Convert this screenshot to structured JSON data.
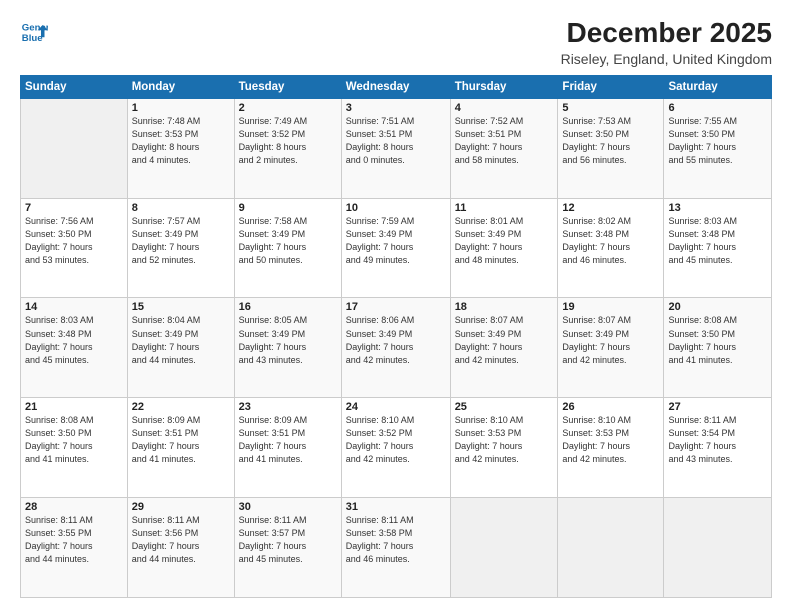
{
  "header": {
    "logo_line1": "General",
    "logo_line2": "Blue",
    "title": "December 2025",
    "subtitle": "Riseley, England, United Kingdom"
  },
  "calendar": {
    "days_of_week": [
      "Sunday",
      "Monday",
      "Tuesday",
      "Wednesday",
      "Thursday",
      "Friday",
      "Saturday"
    ],
    "weeks": [
      [
        {
          "day": "",
          "info": ""
        },
        {
          "day": "1",
          "info": "Sunrise: 7:48 AM\nSunset: 3:53 PM\nDaylight: 8 hours\nand 4 minutes."
        },
        {
          "day": "2",
          "info": "Sunrise: 7:49 AM\nSunset: 3:52 PM\nDaylight: 8 hours\nand 2 minutes."
        },
        {
          "day": "3",
          "info": "Sunrise: 7:51 AM\nSunset: 3:51 PM\nDaylight: 8 hours\nand 0 minutes."
        },
        {
          "day": "4",
          "info": "Sunrise: 7:52 AM\nSunset: 3:51 PM\nDaylight: 7 hours\nand 58 minutes."
        },
        {
          "day": "5",
          "info": "Sunrise: 7:53 AM\nSunset: 3:50 PM\nDaylight: 7 hours\nand 56 minutes."
        },
        {
          "day": "6",
          "info": "Sunrise: 7:55 AM\nSunset: 3:50 PM\nDaylight: 7 hours\nand 55 minutes."
        }
      ],
      [
        {
          "day": "7",
          "info": "Sunrise: 7:56 AM\nSunset: 3:50 PM\nDaylight: 7 hours\nand 53 minutes."
        },
        {
          "day": "8",
          "info": "Sunrise: 7:57 AM\nSunset: 3:49 PM\nDaylight: 7 hours\nand 52 minutes."
        },
        {
          "day": "9",
          "info": "Sunrise: 7:58 AM\nSunset: 3:49 PM\nDaylight: 7 hours\nand 50 minutes."
        },
        {
          "day": "10",
          "info": "Sunrise: 7:59 AM\nSunset: 3:49 PM\nDaylight: 7 hours\nand 49 minutes."
        },
        {
          "day": "11",
          "info": "Sunrise: 8:01 AM\nSunset: 3:49 PM\nDaylight: 7 hours\nand 48 minutes."
        },
        {
          "day": "12",
          "info": "Sunrise: 8:02 AM\nSunset: 3:48 PM\nDaylight: 7 hours\nand 46 minutes."
        },
        {
          "day": "13",
          "info": "Sunrise: 8:03 AM\nSunset: 3:48 PM\nDaylight: 7 hours\nand 45 minutes."
        }
      ],
      [
        {
          "day": "14",
          "info": "Sunrise: 8:03 AM\nSunset: 3:48 PM\nDaylight: 7 hours\nand 45 minutes."
        },
        {
          "day": "15",
          "info": "Sunrise: 8:04 AM\nSunset: 3:49 PM\nDaylight: 7 hours\nand 44 minutes."
        },
        {
          "day": "16",
          "info": "Sunrise: 8:05 AM\nSunset: 3:49 PM\nDaylight: 7 hours\nand 43 minutes."
        },
        {
          "day": "17",
          "info": "Sunrise: 8:06 AM\nSunset: 3:49 PM\nDaylight: 7 hours\nand 42 minutes."
        },
        {
          "day": "18",
          "info": "Sunrise: 8:07 AM\nSunset: 3:49 PM\nDaylight: 7 hours\nand 42 minutes."
        },
        {
          "day": "19",
          "info": "Sunrise: 8:07 AM\nSunset: 3:49 PM\nDaylight: 7 hours\nand 42 minutes."
        },
        {
          "day": "20",
          "info": "Sunrise: 8:08 AM\nSunset: 3:50 PM\nDaylight: 7 hours\nand 41 minutes."
        }
      ],
      [
        {
          "day": "21",
          "info": "Sunrise: 8:08 AM\nSunset: 3:50 PM\nDaylight: 7 hours\nand 41 minutes."
        },
        {
          "day": "22",
          "info": "Sunrise: 8:09 AM\nSunset: 3:51 PM\nDaylight: 7 hours\nand 41 minutes."
        },
        {
          "day": "23",
          "info": "Sunrise: 8:09 AM\nSunset: 3:51 PM\nDaylight: 7 hours\nand 41 minutes."
        },
        {
          "day": "24",
          "info": "Sunrise: 8:10 AM\nSunset: 3:52 PM\nDaylight: 7 hours\nand 42 minutes."
        },
        {
          "day": "25",
          "info": "Sunrise: 8:10 AM\nSunset: 3:53 PM\nDaylight: 7 hours\nand 42 minutes."
        },
        {
          "day": "26",
          "info": "Sunrise: 8:10 AM\nSunset: 3:53 PM\nDaylight: 7 hours\nand 42 minutes."
        },
        {
          "day": "27",
          "info": "Sunrise: 8:11 AM\nSunset: 3:54 PM\nDaylight: 7 hours\nand 43 minutes."
        }
      ],
      [
        {
          "day": "28",
          "info": "Sunrise: 8:11 AM\nSunset: 3:55 PM\nDaylight: 7 hours\nand 44 minutes."
        },
        {
          "day": "29",
          "info": "Sunrise: 8:11 AM\nSunset: 3:56 PM\nDaylight: 7 hours\nand 44 minutes."
        },
        {
          "day": "30",
          "info": "Sunrise: 8:11 AM\nSunset: 3:57 PM\nDaylight: 7 hours\nand 45 minutes."
        },
        {
          "day": "31",
          "info": "Sunrise: 8:11 AM\nSunset: 3:58 PM\nDaylight: 7 hours\nand 46 minutes."
        },
        {
          "day": "",
          "info": ""
        },
        {
          "day": "",
          "info": ""
        },
        {
          "day": "",
          "info": ""
        }
      ]
    ]
  }
}
